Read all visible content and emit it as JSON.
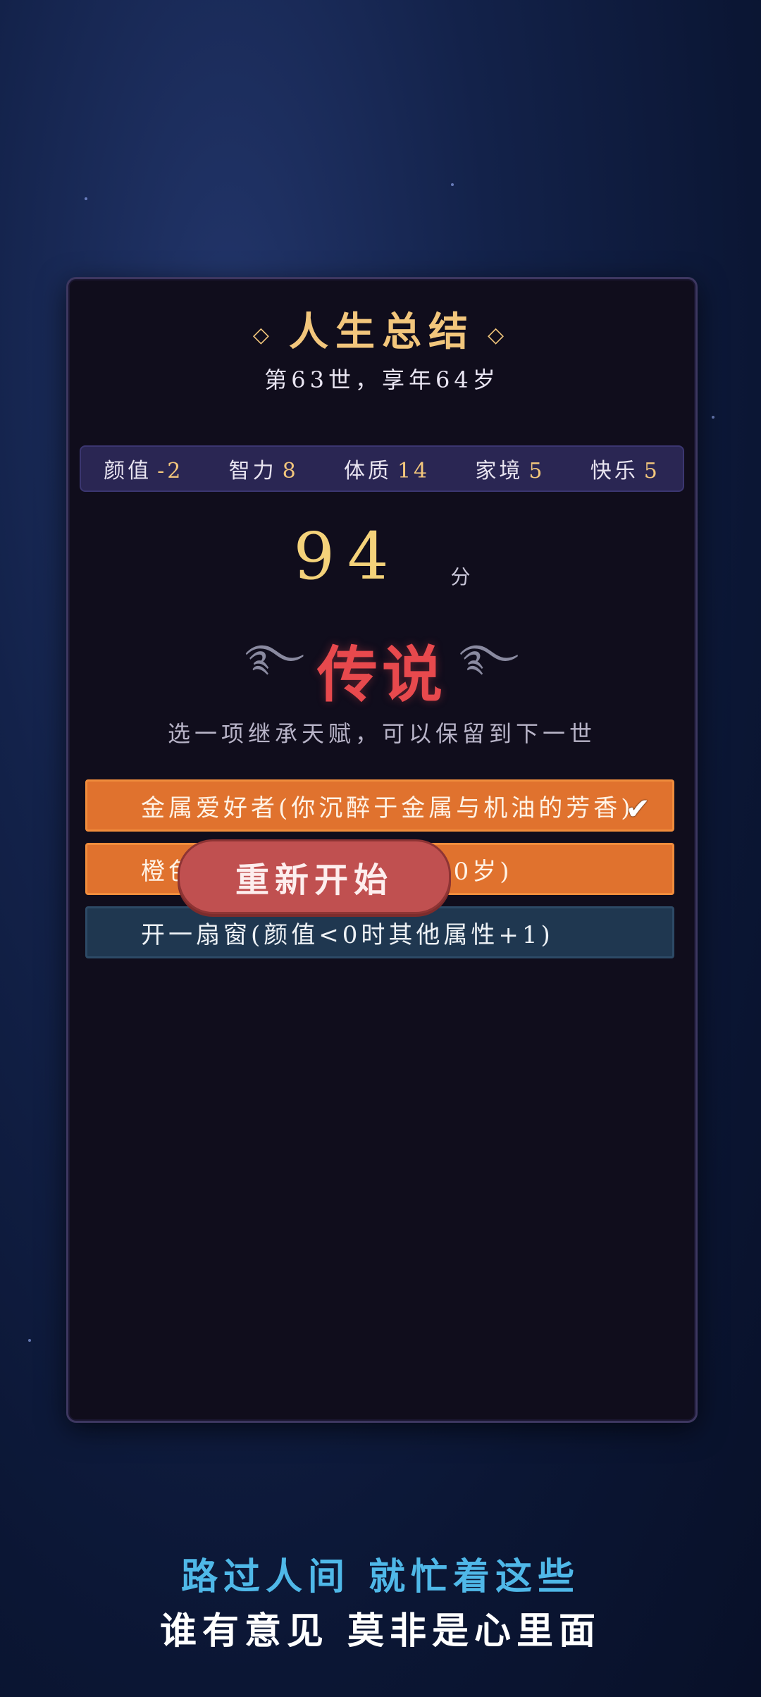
{
  "summary": {
    "title": "人生总结",
    "subtitle": "第63世，享年64岁"
  },
  "stats": [
    {
      "label": "颜值",
      "value": "-2"
    },
    {
      "label": "智力",
      "value": "8"
    },
    {
      "label": "体质",
      "value": "14"
    },
    {
      "label": "家境",
      "value": "5"
    },
    {
      "label": "快乐",
      "value": "5"
    }
  ],
  "score": {
    "value": "94",
    "unit": "分"
  },
  "rank": "传说",
  "hint": "选一项继承天赋，可以保留到下一世",
  "talents": [
    {
      "text": "金属爱好者(你沉醉于金属与机油的芳香)",
      "selected": true,
      "checked": true
    },
    {
      "text": "橙色胶囊(跳过你的60~90岁)",
      "selected": true,
      "checked": false
    },
    {
      "text": "开一扇窗(颜值<0时其他属性+1)",
      "selected": false,
      "checked": false
    }
  ],
  "restart_label": "重新开始",
  "lyrics": {
    "line1": "路过人间 就忙着这些",
    "line2": "谁有意见 莫非是心里面"
  },
  "colors": {
    "accent_gold": "#f2c67c",
    "rank_red": "#e8494d",
    "talent_selected": "#e0722e",
    "talent_unselected": "#1f3750",
    "restart_button": "#c05050",
    "lyric_blue": "#4fb8e8"
  }
}
